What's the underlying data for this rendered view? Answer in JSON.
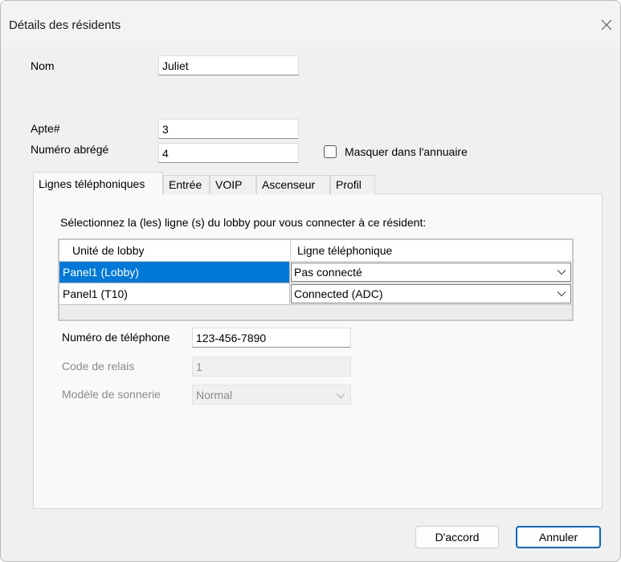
{
  "window": {
    "title": "Détails des résidents"
  },
  "fields": {
    "nom_label": "Nom",
    "nom_value": "Juliet",
    "apte_label": "Apte#",
    "apte_value": "3",
    "numero_abrege_label": "Numéro abrégé",
    "numero_abrege_value": "4",
    "masquer_label": "Masquer dans l'annuaire",
    "masquer_checked": false
  },
  "tabs": [
    {
      "label": "Lignes téléphoniques",
      "active": true
    },
    {
      "label": "Entrée",
      "active": false
    },
    {
      "label": "VOIP",
      "active": false
    },
    {
      "label": "Ascenseur",
      "active": false
    },
    {
      "label": "Profil",
      "active": false
    }
  ],
  "panel": {
    "instruction": "Sélectionnez la (les) ligne (s) du lobby pour vous connecter à ce résident:",
    "table": {
      "columns": [
        "Unité de lobby",
        "Ligne téléphonique"
      ],
      "rows": [
        {
          "unit": "Panel1 (Lobby)",
          "line": "Pas connecté",
          "selected": true
        },
        {
          "unit": "Panel1 (T10)",
          "line": "Connected (ADC)",
          "selected": false
        }
      ]
    },
    "phone_label": "Numéro de téléphone",
    "phone_value": "123-456-7890",
    "relay_label": "Code de relais",
    "relay_value": "1",
    "ring_label": "Modèle de sonnerie",
    "ring_value": "Normal"
  },
  "buttons": {
    "ok": "D'accord",
    "cancel": "Annuler"
  },
  "colors": {
    "selection": "#0078d7",
    "primary_border": "#0067c0",
    "disabled_text": "#8a8a8a"
  },
  "icons": {
    "close": "close-icon",
    "dropdown": "chevron-down-icon",
    "checkbox": "checkbox"
  }
}
